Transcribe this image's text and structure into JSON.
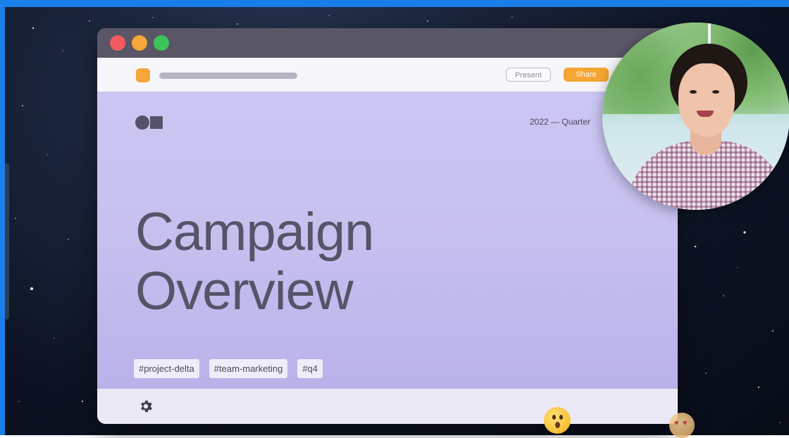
{
  "window": {
    "toolbar": {
      "present_label": "Present",
      "share_label": "Share"
    }
  },
  "slide": {
    "date_label": "2022 — Quarter",
    "headline_line1": "Campaign",
    "headline_line2": "Overview",
    "tags": [
      "#project-delta",
      "#team-marketing",
      "#q4"
    ]
  },
  "reactions": [
    "surprised-face-emoji",
    "heart-eyes-emoji"
  ],
  "colors": {
    "frame_border": "#1a7fe8",
    "accent": "#f5a531",
    "slide_bg": "#cbc6f2",
    "text_dark": "#555468"
  },
  "icons": {
    "settings": "gear-icon"
  }
}
